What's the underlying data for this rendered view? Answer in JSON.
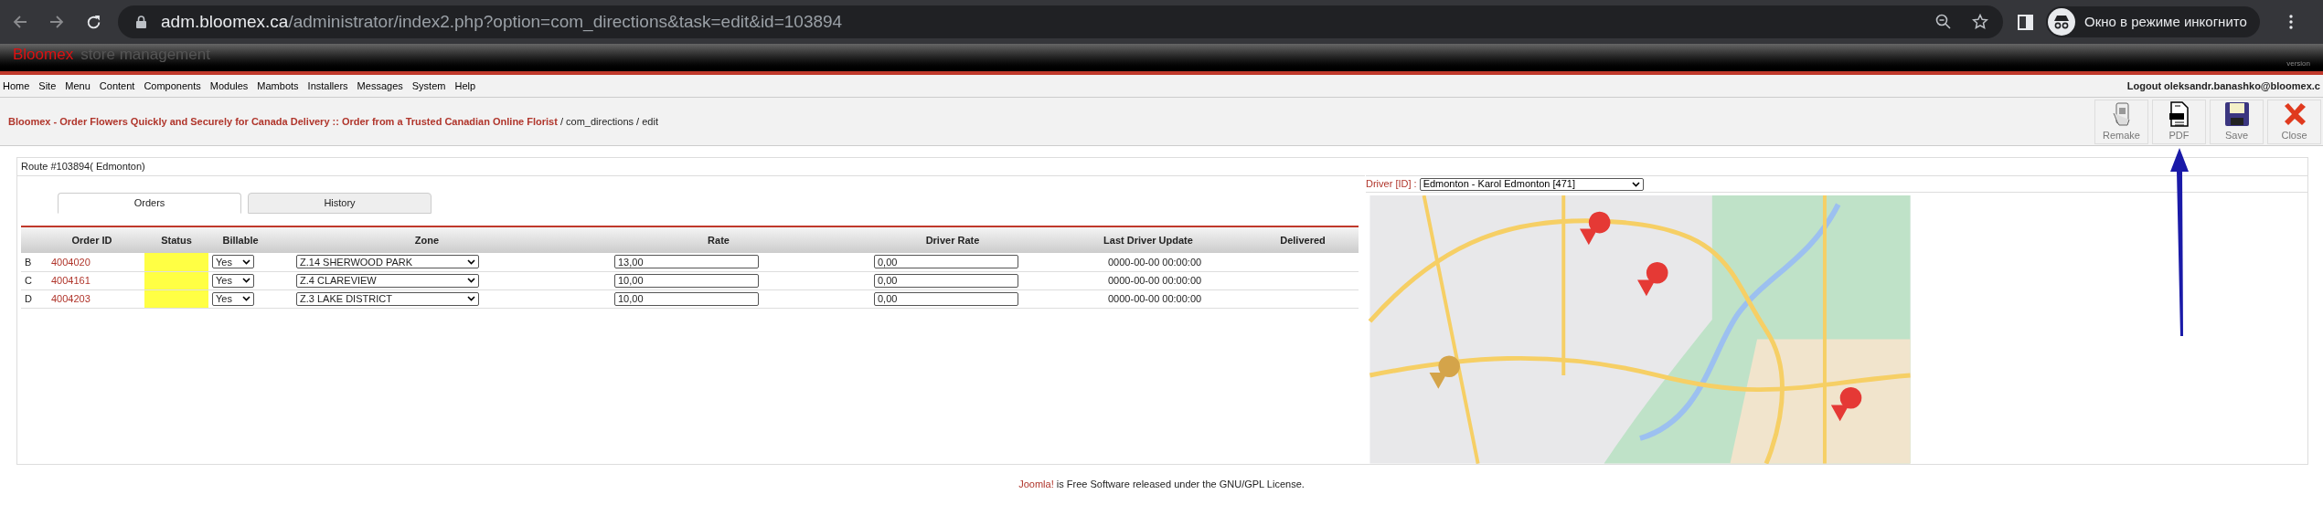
{
  "browser": {
    "url_host": "adm.bloomex.ca",
    "url_path": "/administrator/index2.php?option=com_directions&task=edit&id=103894",
    "profile_label": "Окно в режиме инкогнито"
  },
  "header": {
    "brand": "Bloomex",
    "subtitle": "store management",
    "version": "version"
  },
  "menu": {
    "items": [
      "Home",
      "Site",
      "Menu",
      "Content",
      "Components",
      "Modules",
      "Mambots",
      "Installers",
      "Messages",
      "System",
      "Help"
    ],
    "logout": "Logout oleksandr.banashko@bloomex.c"
  },
  "breadcrumb": {
    "link": "Bloomex - Order Flowers Quickly and Securely for Canada Delivery :: Order from a Trusted Canadian Online Florist",
    "rest": "/ com_directions / edit"
  },
  "toolbar": [
    {
      "label": "Remake",
      "kind": "remake"
    },
    {
      "label": "PDF",
      "kind": "pdf"
    },
    {
      "label": "Save",
      "kind": "save"
    },
    {
      "label": "Close",
      "kind": "close"
    }
  ],
  "route_title": "Route #103894( Edmonton)",
  "tabs": [
    {
      "label": "Orders",
      "selected": true
    },
    {
      "label": "History",
      "selected": false
    }
  ],
  "table": {
    "columns": [
      "Order ID",
      "Status",
      "Billable",
      "Zone",
      "Rate",
      "Driver Rate",
      "Last Driver Update",
      "Delivered"
    ],
    "rows": [
      {
        "stop": "B",
        "order_id": "4004020",
        "billable": "Yes",
        "zone": "Z.14 SHERWOOD PARK",
        "rate": "13,00",
        "driver_rate": "0,00",
        "last_update": "0000-00-00 00:00:00"
      },
      {
        "stop": "C",
        "order_id": "4004161",
        "billable": "Yes",
        "zone": "Z.4 CLAREVIEW",
        "rate": "10,00",
        "driver_rate": "0,00",
        "last_update": "0000-00-00 00:00:00"
      },
      {
        "stop": "D",
        "order_id": "4004203",
        "billable": "Yes",
        "zone": "Z.3 LAKE DISTRICT",
        "rate": "10,00",
        "driver_rate": "0,00",
        "last_update": "0000-00-00 00:00:00"
      }
    ]
  },
  "driver": {
    "label": "Driver [ID] :",
    "value": "Edmonton - Karol Edmonton [471]"
  },
  "footer": {
    "link": "Joomla!",
    "text": "is Free Software released under the GNU/GPL License."
  }
}
